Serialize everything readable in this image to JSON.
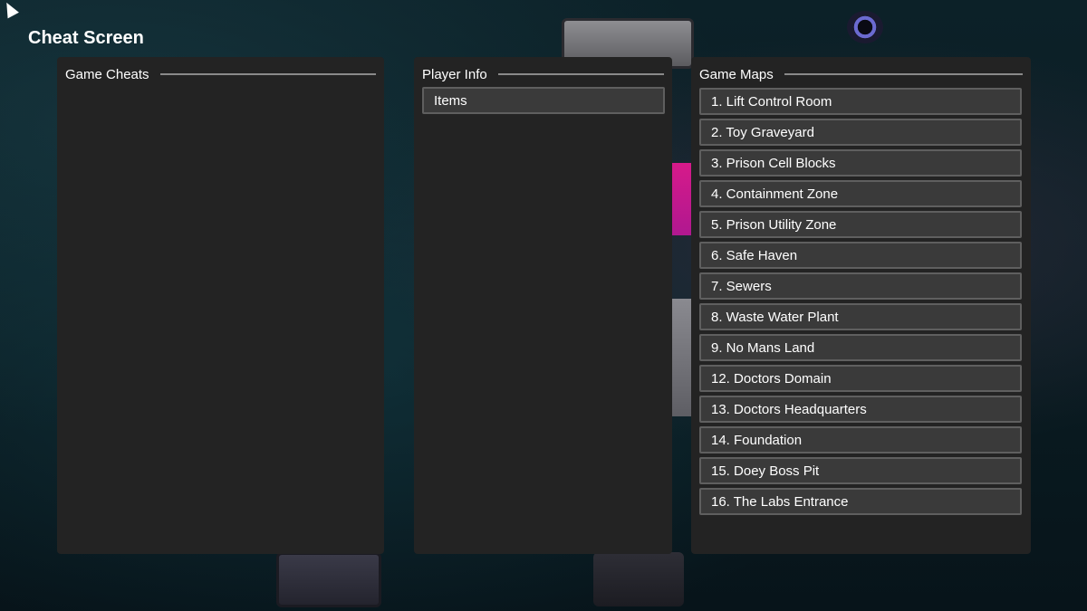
{
  "screen": {
    "title": "Cheat Screen"
  },
  "panels": {
    "cheats": {
      "title": "Game Cheats"
    },
    "player": {
      "title": "Player Info",
      "items": [
        "Items"
      ]
    },
    "maps": {
      "title": "Game Maps",
      "items": [
        "1. Lift Control Room",
        "2. Toy Graveyard",
        "3. Prison Cell Blocks",
        "4. Containment Zone",
        "5. Prison Utility Zone",
        "6. Safe Haven",
        "7. Sewers",
        "8. Waste Water Plant",
        "9. No Mans Land",
        "12. Doctors Domain",
        "13. Doctors Headquarters",
        "14. Foundation",
        "15. Doey Boss Pit",
        "16. The Labs Entrance"
      ]
    }
  }
}
